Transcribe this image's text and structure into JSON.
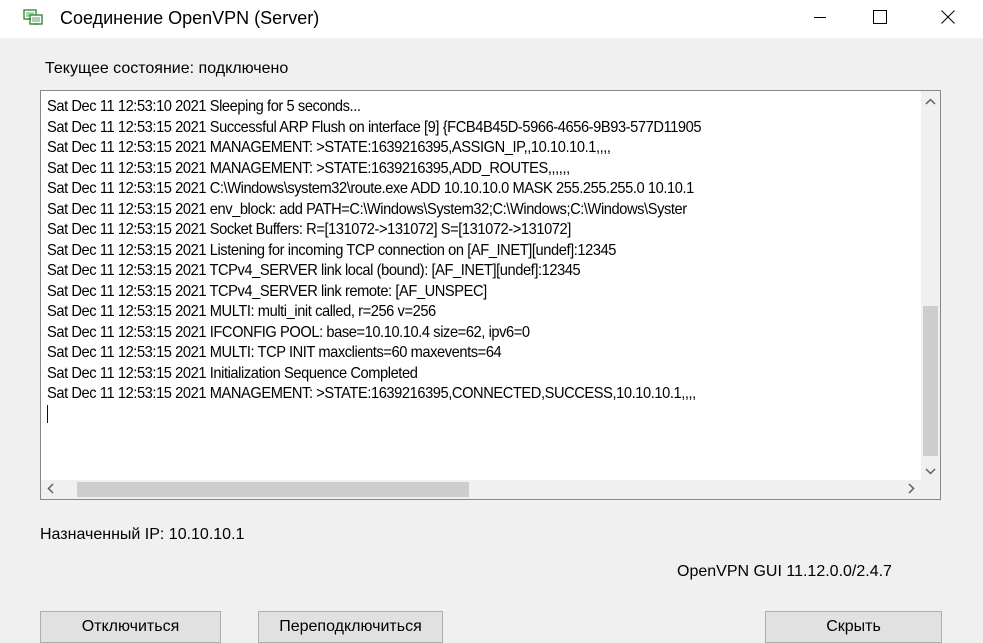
{
  "window": {
    "title": "Соединение OpenVPN (Server)",
    "icon": "network-monitor-icon",
    "controls": {
      "minimize_icon": "minimize-icon",
      "maximize_icon": "maximize-icon",
      "close_icon": "close-icon"
    }
  },
  "status": {
    "text": "Текущее состояние: подключено"
  },
  "log": {
    "lines": [
      "Sat Dec 11 12:53:10 2021 Sleeping for 5 seconds...",
      "Sat Dec 11 12:53:15 2021 Successful ARP Flush on interface [9] {FCB4B45D-5966-4656-9B93-577D11905",
      "Sat Dec 11 12:53:15 2021 MANAGEMENT: >STATE:1639216395,ASSIGN_IP,,10.10.10.1,,,,",
      "Sat Dec 11 12:53:15 2021 MANAGEMENT: >STATE:1639216395,ADD_ROUTES,,,,,,",
      "Sat Dec 11 12:53:15 2021 C:\\Windows\\system32\\route.exe ADD 10.10.10.0 MASK 255.255.255.0 10.10.1",
      "Sat Dec 11 12:53:15 2021 env_block: add PATH=C:\\Windows\\System32;C:\\Windows;C:\\Windows\\Syster",
      "Sat Dec 11 12:53:15 2021 Socket Buffers: R=[131072->131072] S=[131072->131072]",
      "Sat Dec 11 12:53:15 2021 Listening for incoming TCP connection on [AF_INET][undef]:12345",
      "Sat Dec 11 12:53:15 2021 TCPv4_SERVER link local (bound): [AF_INET][undef]:12345",
      "Sat Dec 11 12:53:15 2021 TCPv4_SERVER link remote: [AF_UNSPEC]",
      "Sat Dec 11 12:53:15 2021 MULTI: multi_init called, r=256 v=256",
      "Sat Dec 11 12:53:15 2021 IFCONFIG POOL: base=10.10.10.4 size=62, ipv6=0",
      "Sat Dec 11 12:53:15 2021 MULTI: TCP INIT maxclients=60 maxevents=64",
      "Sat Dec 11 12:53:15 2021 Initialization Sequence Completed",
      "Sat Dec 11 12:53:15 2021 MANAGEMENT: >STATE:1639216395,CONNECTED,SUCCESS,10.10.10.1,,,,"
    ],
    "scrollbar_icons": {
      "up": "chevron-up-icon",
      "down": "chevron-down-icon",
      "left": "chevron-left-icon",
      "right": "chevron-right-icon"
    }
  },
  "assigned_ip": {
    "text": "Назначенный IP: 10.10.10.1"
  },
  "version": {
    "text": "OpenVPN GUI 11.12.0.0/2.4.7"
  },
  "buttons": {
    "disconnect": "Отключиться",
    "reconnect": "Переподключиться",
    "hide": "Скрыть"
  }
}
